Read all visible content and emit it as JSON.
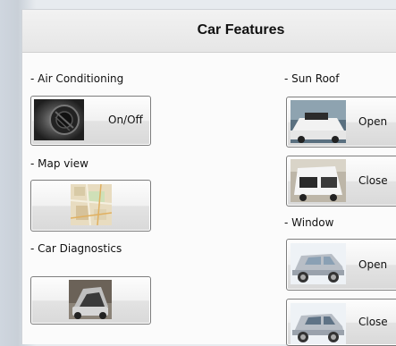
{
  "header": {
    "title": "Car Features"
  },
  "left": {
    "air_label": "- Air Conditioning",
    "air_button": "On/Off",
    "map_label": "- Map view",
    "diag_label": "- Car Diagnostics"
  },
  "right": {
    "sunroof_label": "- Sun Roof",
    "sunroof_open": "Open",
    "sunroof_close": "Close",
    "window_label": "- Window",
    "window_open": "Open",
    "window_close": "Close"
  }
}
